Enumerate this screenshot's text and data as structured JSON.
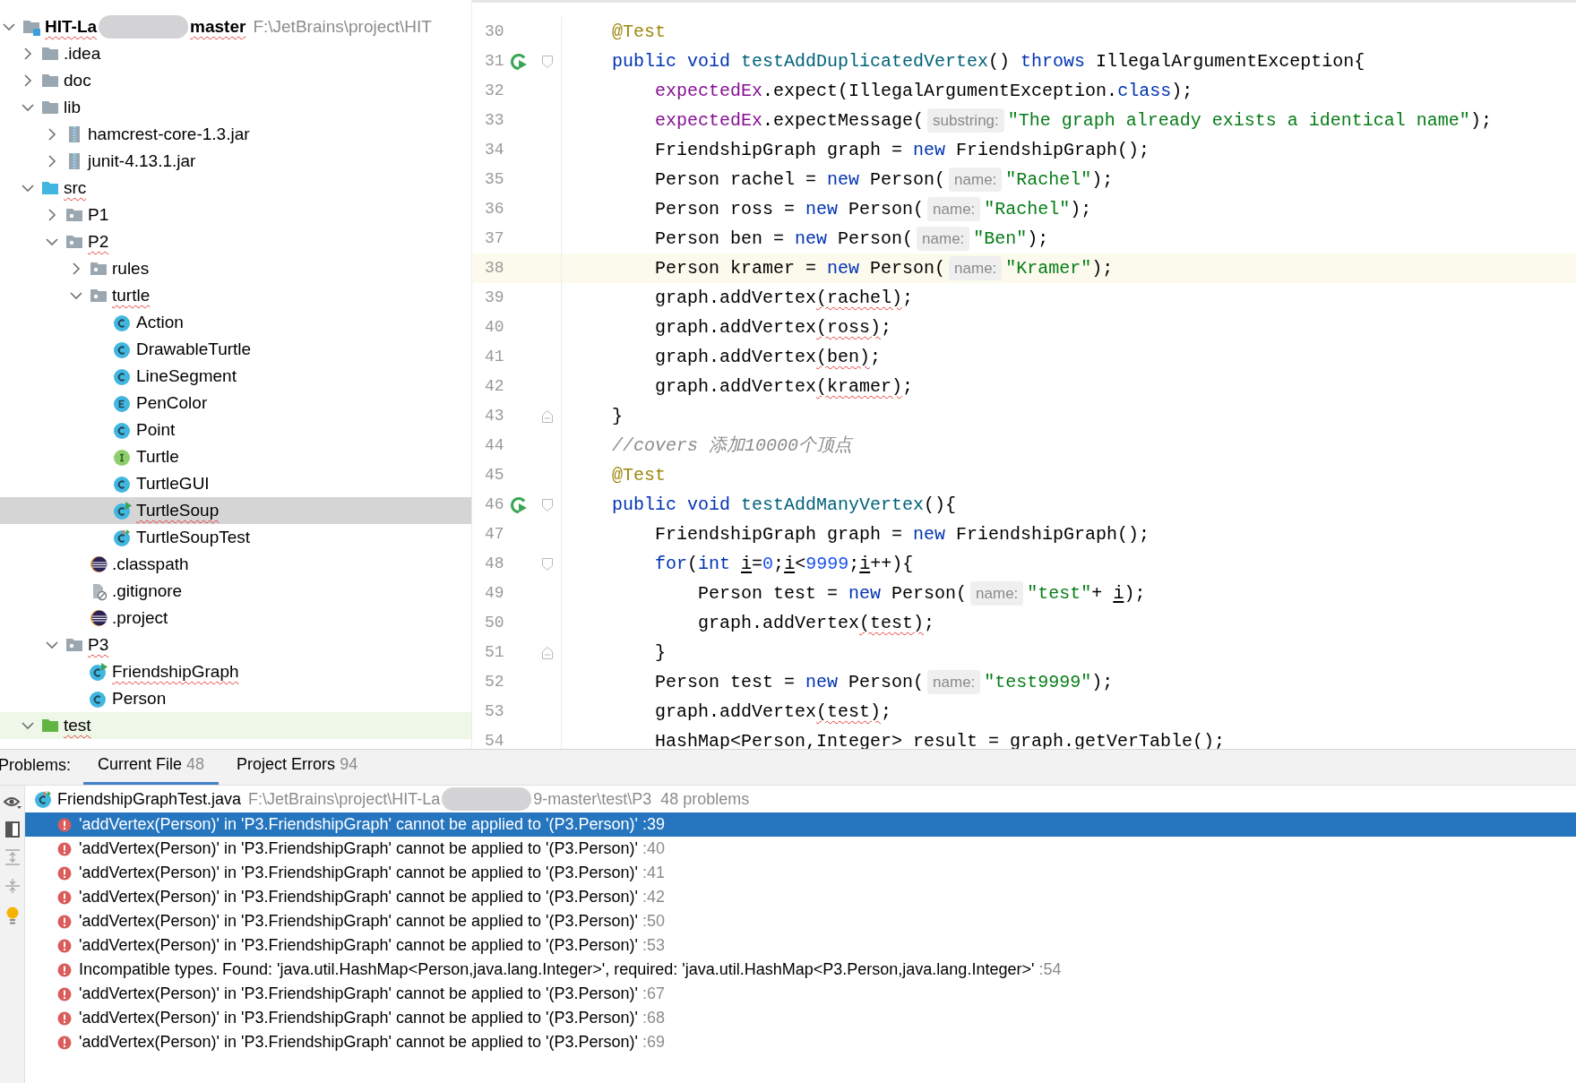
{
  "project_tree": {
    "items": [
      {
        "label": "HIT-La",
        "label_after": "master",
        "path": "F:\\JetBrains\\project\\HIT",
        "kind": "module",
        "expanded": true,
        "selected": false,
        "error": true,
        "children": [
          {
            "label": ".idea",
            "kind": "folder",
            "expanded": false,
            "selected": false,
            "error": false
          },
          {
            "label": "doc",
            "kind": "folder",
            "expanded": false,
            "selected": false,
            "error": false
          },
          {
            "label": "lib",
            "kind": "folder",
            "expanded": true,
            "selected": false,
            "error": false,
            "children": [
              {
                "label": "hamcrest-core-1.3.jar",
                "kind": "jar",
                "expanded": false,
                "selected": false,
                "error": false
              },
              {
                "label": "junit-4.13.1.jar",
                "kind": "jar",
                "expanded": false,
                "selected": false,
                "error": false
              }
            ]
          },
          {
            "label": "src",
            "kind": "source",
            "expanded": true,
            "selected": false,
            "error": true,
            "children": [
              {
                "label": "P1",
                "kind": "package",
                "expanded": false,
                "selected": false,
                "error": false
              },
              {
                "label": "P2",
                "kind": "package",
                "expanded": true,
                "selected": false,
                "error": true,
                "children": [
                  {
                    "label": "rules",
                    "kind": "package",
                    "expanded": false,
                    "selected": false,
                    "error": false
                  },
                  {
                    "label": "turtle",
                    "kind": "package",
                    "expanded": true,
                    "selected": false,
                    "error": true,
                    "children": [
                      {
                        "label": "Action",
                        "kind": "class",
                        "selected": false,
                        "error": false
                      },
                      {
                        "label": "DrawableTurtle",
                        "kind": "class",
                        "selected": false,
                        "error": false
                      },
                      {
                        "label": "LineSegment",
                        "kind": "class",
                        "selected": false,
                        "error": false
                      },
                      {
                        "label": "PenColor",
                        "kind": "enum",
                        "selected": false,
                        "error": false
                      },
                      {
                        "label": "Point",
                        "kind": "class",
                        "selected": false,
                        "error": false
                      },
                      {
                        "label": "Turtle",
                        "kind": "interface",
                        "selected": false,
                        "error": false
                      },
                      {
                        "label": "TurtleGUI",
                        "kind": "class",
                        "selected": false,
                        "error": false
                      },
                      {
                        "label": "TurtleSoup",
                        "kind": "runnable",
                        "selected": true,
                        "error": true
                      },
                      {
                        "label": "TurtleSoupTest",
                        "kind": "testclass",
                        "selected": false,
                        "error": false
                      }
                    ]
                  },
                  {
                    "label": ".classpath",
                    "kind": "eclipse",
                    "selected": false,
                    "error": false
                  },
                  {
                    "label": ".gitignore",
                    "kind": "ignored",
                    "selected": false,
                    "error": false
                  },
                  {
                    "label": ".project",
                    "kind": "eclipse",
                    "selected": false,
                    "error": false
                  }
                ]
              },
              {
                "label": "P3",
                "kind": "package",
                "expanded": true,
                "selected": false,
                "error": true,
                "children": [
                  {
                    "label": "FriendshipGraph",
                    "kind": "runnable",
                    "selected": false,
                    "error": true
                  },
                  {
                    "label": "Person",
                    "kind": "class",
                    "selected": false,
                    "error": false
                  }
                ]
              }
            ]
          },
          {
            "label": "test",
            "kind": "test",
            "expanded": true,
            "selected": false,
            "error": true
          }
        ]
      }
    ]
  },
  "editor": {
    "lines": [
      {
        "number": "30",
        "current": false,
        "run_icon": false,
        "fold_start": false,
        "fold_end": false,
        "segments": [
          {
            "t": "    @Test",
            "kind": "annotation"
          }
        ]
      },
      {
        "number": "31",
        "current": false,
        "run_icon": true,
        "fold_start": true,
        "fold_end": false,
        "segments": [
          {
            "t": "    public void",
            "kind": "keyword"
          },
          {
            "t": " testAddDuplicatedVertex",
            "kind": "method"
          },
          {
            "t": "() ",
            "kind": "plain"
          },
          {
            "t": "throws",
            "kind": "keyword"
          },
          {
            "t": " IllegalArgumentException{",
            "kind": "plain"
          }
        ]
      },
      {
        "number": "32",
        "current": false,
        "run_icon": false,
        "fold_start": false,
        "fold_end": false,
        "segments": [
          {
            "t": "        expectedEx",
            "kind": "field"
          },
          {
            "t": ".expect(IllegalArgumentException.",
            "kind": "plain"
          },
          {
            "t": "class",
            "kind": "keyword"
          },
          {
            "t": ");",
            "kind": "plain"
          }
        ]
      },
      {
        "number": "33",
        "current": false,
        "run_icon": false,
        "fold_start": false,
        "fold_end": false,
        "segments": [
          {
            "t": "        expectedEx",
            "kind": "field"
          },
          {
            "t": ".expectMessage(",
            "kind": "plain"
          },
          {
            "t": "substring:",
            "kind": "hint"
          },
          {
            "t": "\"The graph already exists a identical name\"",
            "kind": "string"
          },
          {
            "t": ");",
            "kind": "plain"
          }
        ]
      },
      {
        "number": "34",
        "current": false,
        "run_icon": false,
        "fold_start": false,
        "fold_end": false,
        "segments": [
          {
            "t": "        FriendshipGraph graph = ",
            "kind": "plain"
          },
          {
            "t": "new",
            "kind": "keyword"
          },
          {
            "t": " FriendshipGraph();",
            "kind": "plain"
          }
        ]
      },
      {
        "number": "35",
        "current": false,
        "run_icon": false,
        "fold_start": false,
        "fold_end": false,
        "segments": [
          {
            "t": "        Person rachel = ",
            "kind": "plain"
          },
          {
            "t": "new",
            "kind": "keyword"
          },
          {
            "t": " Person(",
            "kind": "plain"
          },
          {
            "t": "name:",
            "kind": "hint"
          },
          {
            "t": "\"Rachel\"",
            "kind": "string"
          },
          {
            "t": ");",
            "kind": "plain"
          }
        ]
      },
      {
        "number": "36",
        "current": false,
        "run_icon": false,
        "fold_start": false,
        "fold_end": false,
        "segments": [
          {
            "t": "        Person ross = ",
            "kind": "plain"
          },
          {
            "t": "new",
            "kind": "keyword"
          },
          {
            "t": " Person(",
            "kind": "plain"
          },
          {
            "t": "name:",
            "kind": "hint"
          },
          {
            "t": "\"Rachel\"",
            "kind": "string"
          },
          {
            "t": ");",
            "kind": "plain"
          }
        ]
      },
      {
        "number": "37",
        "current": false,
        "run_icon": false,
        "fold_start": false,
        "fold_end": false,
        "segments": [
          {
            "t": "        Person ben = ",
            "kind": "plain"
          },
          {
            "t": "new",
            "kind": "keyword"
          },
          {
            "t": " Person(",
            "kind": "plain"
          },
          {
            "t": "name:",
            "kind": "hint"
          },
          {
            "t": "\"Ben\"",
            "kind": "string"
          },
          {
            "t": ");",
            "kind": "plain"
          }
        ]
      },
      {
        "number": "38",
        "current": true,
        "run_icon": false,
        "fold_start": false,
        "fold_end": false,
        "segments": [
          {
            "t": "        Person kramer = ",
            "kind": "plain"
          },
          {
            "t": "new",
            "kind": "keyword"
          },
          {
            "t": " Person(",
            "kind": "plain"
          },
          {
            "t": "name:",
            "kind": "hint"
          },
          {
            "t": "\"Kramer\"",
            "kind": "string"
          },
          {
            "t": ");",
            "kind": "plain"
          }
        ]
      },
      {
        "number": "39",
        "current": false,
        "run_icon": false,
        "fold_start": false,
        "fold_end": false,
        "segments": [
          {
            "t": "        graph.addVertex",
            "kind": "plain"
          },
          {
            "t": "(rachel)",
            "kind": "error"
          },
          {
            "t": ";",
            "kind": "plain"
          }
        ]
      },
      {
        "number": "40",
        "current": false,
        "run_icon": false,
        "fold_start": false,
        "fold_end": false,
        "segments": [
          {
            "t": "        graph.addVertex",
            "kind": "plain"
          },
          {
            "t": "(ross)",
            "kind": "error"
          },
          {
            "t": ";",
            "kind": "plain"
          }
        ]
      },
      {
        "number": "41",
        "current": false,
        "run_icon": false,
        "fold_start": false,
        "fold_end": false,
        "segments": [
          {
            "t": "        graph.addVertex",
            "kind": "plain"
          },
          {
            "t": "(ben)",
            "kind": "error"
          },
          {
            "t": ";",
            "kind": "plain"
          }
        ]
      },
      {
        "number": "42",
        "current": false,
        "run_icon": false,
        "fold_start": false,
        "fold_end": false,
        "segments": [
          {
            "t": "        graph.addVertex",
            "kind": "plain"
          },
          {
            "t": "(kramer)",
            "kind": "error"
          },
          {
            "t": ";",
            "kind": "plain"
          }
        ]
      },
      {
        "number": "43",
        "current": false,
        "run_icon": false,
        "fold_start": false,
        "fold_end": true,
        "segments": [
          {
            "t": "    }",
            "kind": "plain"
          }
        ]
      },
      {
        "number": "44",
        "current": false,
        "run_icon": false,
        "fold_start": false,
        "fold_end": false,
        "segments": [
          {
            "t": "    //covers 添加10000个顶点",
            "kind": "comment"
          }
        ]
      },
      {
        "number": "45",
        "current": false,
        "run_icon": false,
        "fold_start": false,
        "fold_end": false,
        "segments": [
          {
            "t": "    @Test",
            "kind": "annotation"
          }
        ]
      },
      {
        "number": "46",
        "current": false,
        "run_icon": true,
        "fold_start": true,
        "fold_end": false,
        "segments": [
          {
            "t": "    public void",
            "kind": "keyword"
          },
          {
            "t": " testAddManyVertex",
            "kind": "method"
          },
          {
            "t": "(){",
            "kind": "plain"
          }
        ]
      },
      {
        "number": "47",
        "current": false,
        "run_icon": false,
        "fold_start": false,
        "fold_end": false,
        "segments": [
          {
            "t": "        FriendshipGraph graph = ",
            "kind": "plain"
          },
          {
            "t": "new",
            "kind": "keyword"
          },
          {
            "t": " FriendshipGraph();",
            "kind": "plain"
          }
        ]
      },
      {
        "number": "48",
        "current": false,
        "run_icon": false,
        "fold_start": true,
        "fold_end": false,
        "segments": [
          {
            "t": "        for",
            "kind": "keyword"
          },
          {
            "t": "(",
            "kind": "plain"
          },
          {
            "t": "int ",
            "kind": "keyword"
          },
          {
            "t": "i",
            "kind": "variable"
          },
          {
            "t": "=",
            "kind": "plain"
          },
          {
            "t": "0",
            "kind": "number"
          },
          {
            "t": ";",
            "kind": "plain"
          },
          {
            "t": "i",
            "kind": "variable"
          },
          {
            "t": "<",
            "kind": "plain"
          },
          {
            "t": "9999",
            "kind": "number"
          },
          {
            "t": ";",
            "kind": "plain"
          },
          {
            "t": "i",
            "kind": "variable"
          },
          {
            "t": "++){",
            "kind": "plain"
          }
        ]
      },
      {
        "number": "49",
        "current": false,
        "run_icon": false,
        "fold_start": false,
        "fold_end": false,
        "segments": [
          {
            "t": "            Person test = ",
            "kind": "plain"
          },
          {
            "t": "new",
            "kind": "keyword"
          },
          {
            "t": " Person(",
            "kind": "plain"
          },
          {
            "t": "name:",
            "kind": "hint"
          },
          {
            "t": "\"test\"",
            "kind": "string"
          },
          {
            "t": "+ ",
            "kind": "plain"
          },
          {
            "t": "i",
            "kind": "variable"
          },
          {
            "t": ");",
            "kind": "plain"
          }
        ]
      },
      {
        "number": "50",
        "current": false,
        "run_icon": false,
        "fold_start": false,
        "fold_end": false,
        "segments": [
          {
            "t": "            graph.addVertex",
            "kind": "plain"
          },
          {
            "t": "(test)",
            "kind": "error"
          },
          {
            "t": ";",
            "kind": "plain"
          }
        ]
      },
      {
        "number": "51",
        "current": false,
        "run_icon": false,
        "fold_start": false,
        "fold_end": true,
        "segments": [
          {
            "t": "        }",
            "kind": "plain"
          }
        ]
      },
      {
        "number": "52",
        "current": false,
        "run_icon": false,
        "fold_start": false,
        "fold_end": false,
        "segments": [
          {
            "t": "        Person test = ",
            "kind": "plain"
          },
          {
            "t": "new",
            "kind": "keyword"
          },
          {
            "t": " Person(",
            "kind": "plain"
          },
          {
            "t": "name:",
            "kind": "hint"
          },
          {
            "t": "\"test9999\"",
            "kind": "string"
          },
          {
            "t": ");",
            "kind": "plain"
          }
        ]
      },
      {
        "number": "53",
        "current": false,
        "run_icon": false,
        "fold_start": false,
        "fold_end": false,
        "segments": [
          {
            "t": "        graph.addVertex",
            "kind": "plain"
          },
          {
            "t": "(test)",
            "kind": "error"
          },
          {
            "t": ";",
            "kind": "plain"
          }
        ]
      },
      {
        "number": "54",
        "current": false,
        "run_icon": false,
        "fold_start": false,
        "fold_end": false,
        "segments": [
          {
            "t": "        HashMap<Person,Integer> result = graph.getVerTable();",
            "kind": "plain"
          }
        ]
      }
    ]
  },
  "problems": {
    "title": "Problems:",
    "tabs": [
      {
        "label": "Current File",
        "count": "48",
        "selected": true
      },
      {
        "label": "Project Errors",
        "count": "94",
        "selected": false
      }
    ],
    "file": {
      "name": "FriendshipGraphTest.java",
      "path_start": "F:\\JetBrains\\project\\HIT-La",
      "path_end": "9-master\\test\\P3",
      "count": "48 problems"
    },
    "items": [
      {
        "message": "'addVertex(Person)' in 'P3.FriendshipGraph' cannot be applied to '(P3.Person)'",
        "line": ":39",
        "selected": true
      },
      {
        "message": "'addVertex(Person)' in 'P3.FriendshipGraph' cannot be applied to '(P3.Person)'",
        "line": ":40",
        "selected": false
      },
      {
        "message": "'addVertex(Person)' in 'P3.FriendshipGraph' cannot be applied to '(P3.Person)'",
        "line": ":41",
        "selected": false
      },
      {
        "message": "'addVertex(Person)' in 'P3.FriendshipGraph' cannot be applied to '(P3.Person)'",
        "line": ":42",
        "selected": false
      },
      {
        "message": "'addVertex(Person)' in 'P3.FriendshipGraph' cannot be applied to '(P3.Person)'",
        "line": ":50",
        "selected": false
      },
      {
        "message": "'addVertex(Person)' in 'P3.FriendshipGraph' cannot be applied to '(P3.Person)'",
        "line": ":53",
        "selected": false
      },
      {
        "message": "Incompatible types. Found: 'java.util.HashMap<Person,java.lang.Integer>', required: 'java.util.HashMap<P3.Person,java.lang.Integer>'",
        "line": ":54",
        "selected": false
      },
      {
        "message": "'addVertex(Person)' in 'P3.FriendshipGraph' cannot be applied to '(P3.Person)'",
        "line": ":67",
        "selected": false
      },
      {
        "message": "'addVertex(Person)' in 'P3.FriendshipGraph' cannot be applied to '(P3.Person)'",
        "line": ":68",
        "selected": false
      },
      {
        "message": "'addVertex(Person)' in 'P3.FriendshipGraph' cannot be applied to '(P3.Person)'",
        "line": ":69",
        "selected": false
      }
    ]
  }
}
